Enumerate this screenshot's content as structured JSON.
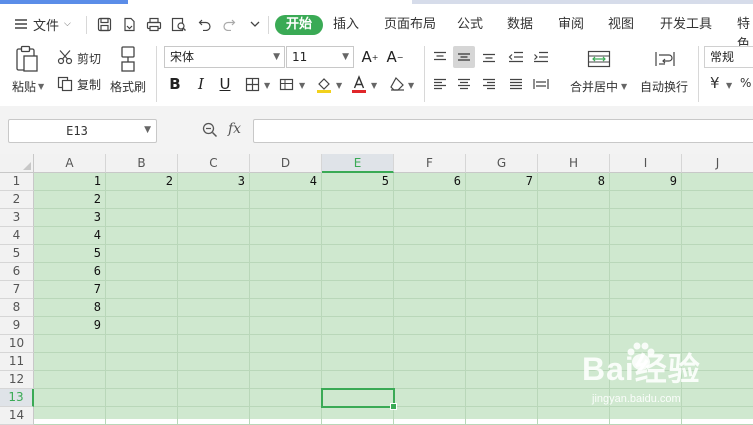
{
  "menu": {
    "file_label": "文件",
    "tabs": [
      "开始",
      "插入",
      "页面布局",
      "公式",
      "数据",
      "审阅",
      "视图",
      "开发工具",
      "特色"
    ]
  },
  "ribbon": {
    "paste_label": "粘贴",
    "cut_label": "剪切",
    "copy_label": "复制",
    "format_painter_label": "格式刷",
    "font_name": "宋体",
    "font_size": "11",
    "merge_center_label": "合并居中",
    "wrap_text_label": "自动换行",
    "number_format": "常规",
    "currency_symbol": "¥"
  },
  "formula_bar": {
    "name_box": "E13",
    "fx_label": "fx",
    "formula": ""
  },
  "grid": {
    "columns": [
      "A",
      "B",
      "C",
      "D",
      "E",
      "F",
      "G",
      "H",
      "I",
      "J"
    ],
    "rows": [
      "1",
      "2",
      "3",
      "4",
      "5",
      "6",
      "7",
      "8",
      "9",
      "10",
      "11",
      "12",
      "13",
      "14"
    ],
    "active_column": "E",
    "active_row": "13",
    "values": [
      [
        "1",
        "2",
        "3",
        "4",
        "5",
        "6",
        "7",
        "8",
        "9",
        ""
      ],
      [
        "2",
        "",
        "",
        "",
        "",
        "",
        "",
        "",
        "",
        ""
      ],
      [
        "3",
        "",
        "",
        "",
        "",
        "",
        "",
        "",
        "",
        ""
      ],
      [
        "4",
        "",
        "",
        "",
        "",
        "",
        "",
        "",
        "",
        ""
      ],
      [
        "5",
        "",
        "",
        "",
        "",
        "",
        "",
        "",
        "",
        ""
      ],
      [
        "6",
        "",
        "",
        "",
        "",
        "",
        "",
        "",
        "",
        ""
      ],
      [
        "7",
        "",
        "",
        "",
        "",
        "",
        "",
        "",
        "",
        ""
      ],
      [
        "8",
        "",
        "",
        "",
        "",
        "",
        "",
        "",
        "",
        ""
      ],
      [
        "9",
        "",
        "",
        "",
        "",
        "",
        "",
        "",
        "",
        ""
      ],
      [
        "",
        "",
        "",
        "",
        "",
        "",
        "",
        "",
        "",
        ""
      ],
      [
        "",
        "",
        "",
        "",
        "",
        "",
        "",
        "",
        "",
        ""
      ],
      [
        "",
        "",
        "",
        "",
        "",
        "",
        "",
        "",
        "",
        ""
      ],
      [
        "",
        "",
        "",
        "",
        "",
        "",
        "",
        "",
        "",
        ""
      ],
      [
        "",
        "",
        "",
        "",
        "",
        "",
        "",
        "",
        "",
        ""
      ]
    ]
  },
  "colors": {
    "accent": "#3aaa55",
    "cell_fill": "#cfe8cf"
  },
  "watermark": {
    "brand": "Bai经验",
    "url": "jingyan.baidu.com"
  }
}
